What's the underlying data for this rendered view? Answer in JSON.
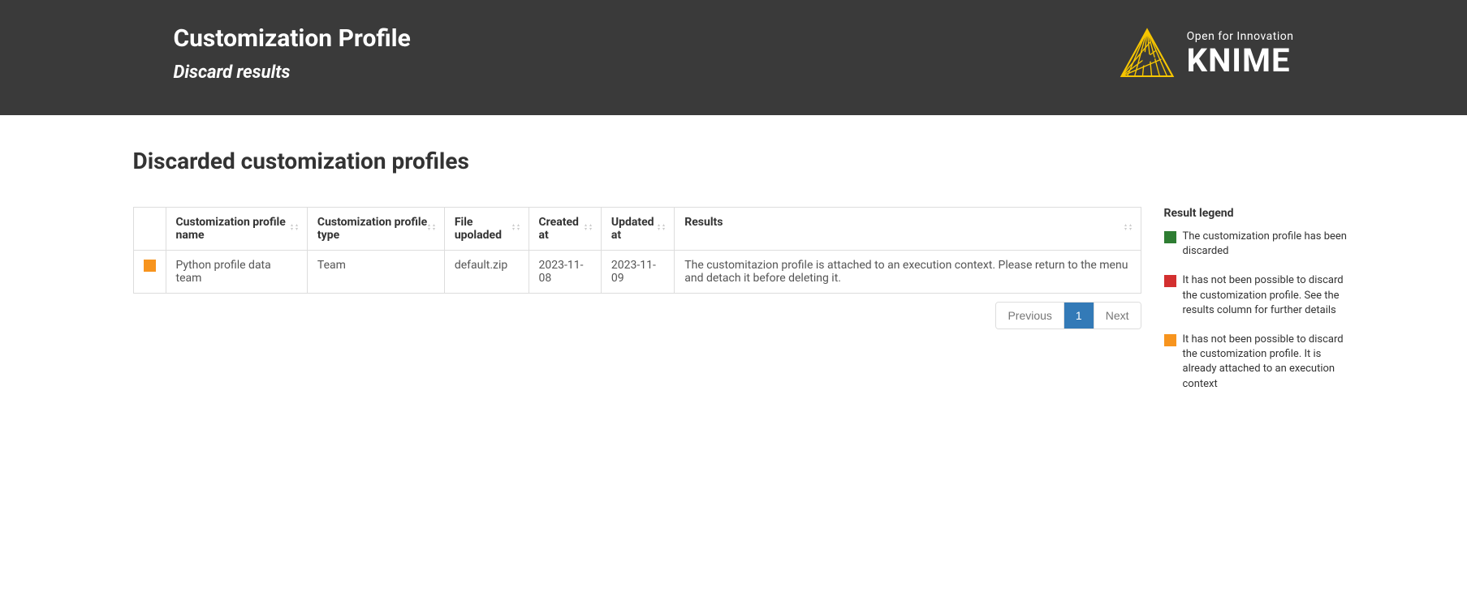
{
  "header": {
    "title": "Customization Profile",
    "subtitle": "Discard results",
    "logo_tagline": "Open for Innovation",
    "logo_name": "KNIME"
  },
  "section_title": "Discarded customization profiles",
  "table": {
    "columns": {
      "name": "Customization profile name",
      "type": "Customization profile type",
      "file": "File upoladed",
      "created": "Created at",
      "updated": "Updated at",
      "results": "Results"
    },
    "row": {
      "status_color": "#f7941e",
      "name": "Python profile data team",
      "type": "Team",
      "file": "default.zip",
      "created": "2023-11-08",
      "updated": "2023-11-09",
      "results": "The customitazion profile is attached to an execution context. Please return to the menu and detach it before deleting it."
    }
  },
  "pagination": {
    "previous": "Previous",
    "page1": "1",
    "next": "Next"
  },
  "legend": {
    "title": "Result legend",
    "items": {
      "green": {
        "color": "#2e7d32",
        "text": "The customization profile has been discarded"
      },
      "red": {
        "color": "#d32f2f",
        "text": "It has not been possible to discard the customization profile. See the results column for further details"
      },
      "orange": {
        "color": "#f7941e",
        "text": "It has not been possible to discard the customization profile. It is already attached to an execution context"
      }
    }
  }
}
